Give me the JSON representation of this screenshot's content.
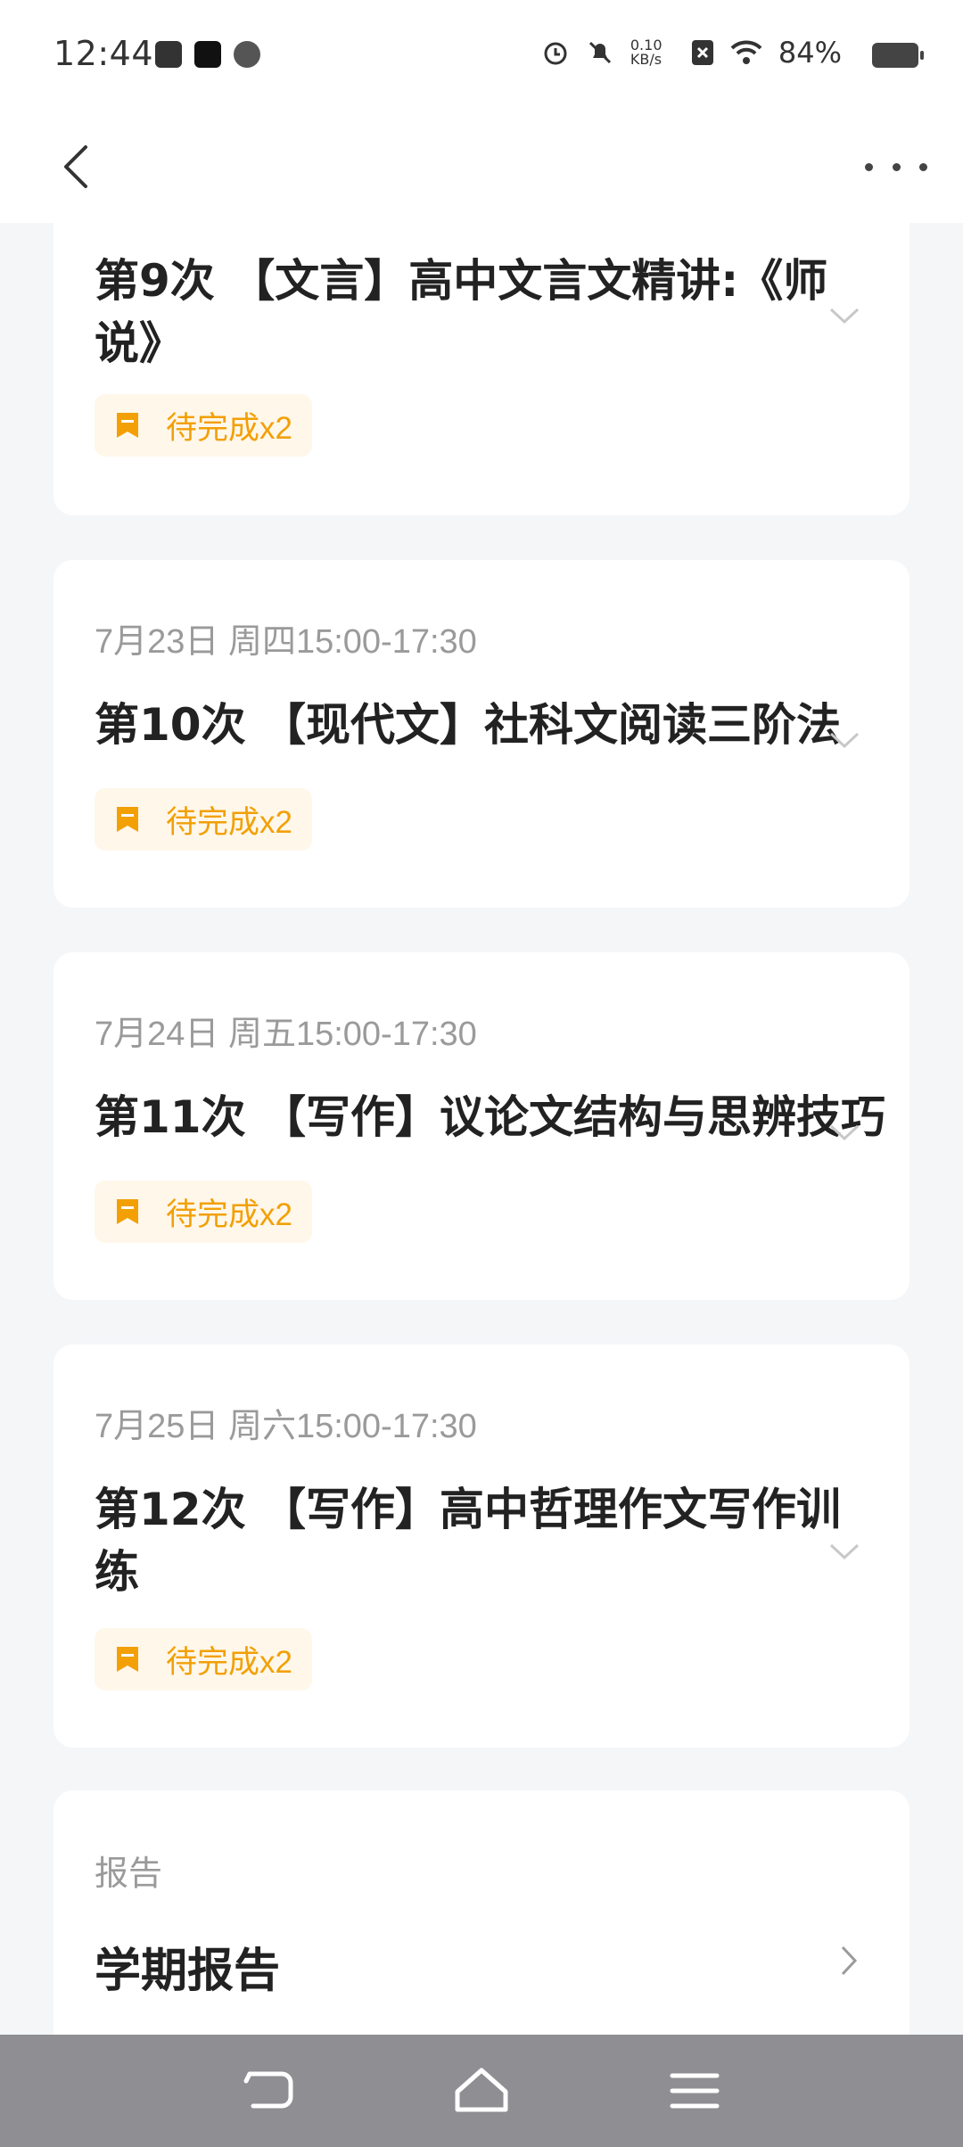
{
  "status_bar": {
    "time": "12:44",
    "net_speed": "0.10 KB/s",
    "battery": "84%"
  },
  "header": {
    "back_icon": "chevron-left-icon",
    "more_icon": "more-dots-icon"
  },
  "sessions": [
    {
      "date": "",
      "title": "第9次 【文言】高中文言文精讲:《师说》",
      "tag": "待完成x2"
    },
    {
      "date": "7月23日 周四15:00-17:30",
      "title": "第10次 【现代文】社科文阅读三阶法",
      "tag": "待完成x2"
    },
    {
      "date": "7月24日 周五15:00-17:30",
      "title": "第11次 【写作】议论文结构与思辨技巧",
      "tag": "待完成x2"
    },
    {
      "date": "7月25日 周六15:00-17:30",
      "title": "第12次 【写作】高中哲理作文写作训练",
      "tag": "待完成x2"
    }
  ],
  "report": {
    "label": "报告",
    "title": "学期报告"
  },
  "colors": {
    "accent_tag_text": "#f2a006",
    "accent_tag_bg": "#fff7ea",
    "page_bg": "#f5f6f8",
    "nav_bar": "#8e8e93"
  }
}
